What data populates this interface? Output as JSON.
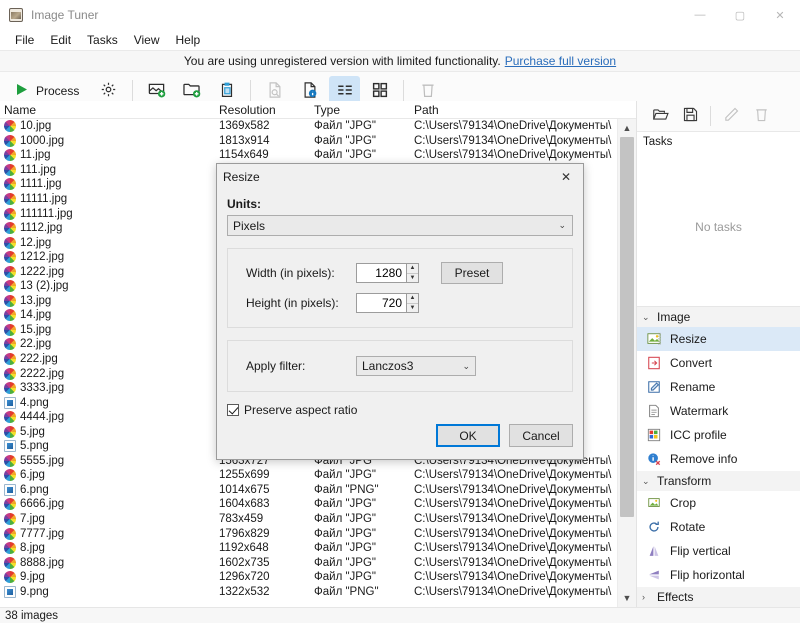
{
  "window": {
    "title": "Image Tuner",
    "app_icon": "image-tuner-icon",
    "minimize": "—",
    "maximize": "▢",
    "close": "✕"
  },
  "menu": [
    "File",
    "Edit",
    "Tasks",
    "View",
    "Help"
  ],
  "nag": {
    "text": "You are using unregistered version with limited functionality.",
    "link": "Purchase full version"
  },
  "toolbar": {
    "process_label": "Process",
    "items": [
      "settings-icon",
      "add-images-icon",
      "add-folder-icon",
      "paste-icon",
      "preview-icon",
      "info-icon",
      "list-view-icon",
      "grid-view-icon",
      "delete-icon"
    ]
  },
  "list": {
    "columns": [
      "Name",
      "Resolution",
      "Type",
      "Path"
    ],
    "rows": [
      {
        "name": "10.jpg",
        "kind": "jpg",
        "res": "1369x582",
        "type": "Файл \"JPG\"",
        "path": "C:\\Users\\79134\\OneDrive\\Документы\\"
      },
      {
        "name": "1000.jpg",
        "kind": "jpg",
        "res": "1813x914",
        "type": "Файл \"JPG\"",
        "path": "C:\\Users\\79134\\OneDrive\\Документы\\"
      },
      {
        "name": "11.jpg",
        "kind": "jpg",
        "res": "1154x649",
        "type": "Файл \"JPG\"",
        "path": "C:\\Users\\79134\\OneDrive\\Документы\\"
      },
      {
        "name": "111.jpg",
        "kind": "jpg",
        "res": "",
        "type": "",
        "path": ""
      },
      {
        "name": "1111.jpg",
        "kind": "jpg",
        "res": "",
        "type": "",
        "path": ""
      },
      {
        "name": "11111.jpg",
        "kind": "jpg",
        "res": "",
        "type": "",
        "path": ""
      },
      {
        "name": "111111.jpg",
        "kind": "jpg",
        "res": "",
        "type": "",
        "path": ""
      },
      {
        "name": "1112.jpg",
        "kind": "jpg",
        "res": "",
        "type": "",
        "path": ""
      },
      {
        "name": "12.jpg",
        "kind": "jpg",
        "res": "",
        "type": "",
        "path": ""
      },
      {
        "name": "1212.jpg",
        "kind": "jpg",
        "res": "",
        "type": "",
        "path": ""
      },
      {
        "name": "1222.jpg",
        "kind": "jpg",
        "res": "",
        "type": "",
        "path": ""
      },
      {
        "name": "13 (2).jpg",
        "kind": "jpg",
        "res": "",
        "type": "",
        "path": ""
      },
      {
        "name": "13.jpg",
        "kind": "jpg",
        "res": "",
        "type": "",
        "path": ""
      },
      {
        "name": "14.jpg",
        "kind": "jpg",
        "res": "",
        "type": "",
        "path": ""
      },
      {
        "name": "15.jpg",
        "kind": "jpg",
        "res": "",
        "type": "",
        "path": ""
      },
      {
        "name": "22.jpg",
        "kind": "jpg",
        "res": "",
        "type": "",
        "path": ""
      },
      {
        "name": "222.jpg",
        "kind": "jpg",
        "res": "",
        "type": "",
        "path": ""
      },
      {
        "name": "2222.jpg",
        "kind": "jpg",
        "res": "",
        "type": "",
        "path": ""
      },
      {
        "name": "3333.jpg",
        "kind": "jpg",
        "res": "",
        "type": "",
        "path": ""
      },
      {
        "name": "4.png",
        "kind": "png",
        "res": "",
        "type": "",
        "path": ""
      },
      {
        "name": "4444.jpg",
        "kind": "jpg",
        "res": "",
        "type": "",
        "path": ""
      },
      {
        "name": "5.jpg",
        "kind": "jpg",
        "res": "",
        "type": "",
        "path": ""
      },
      {
        "name": "5.png",
        "kind": "png",
        "res": "",
        "type": "",
        "path": ""
      },
      {
        "name": "5555.jpg",
        "kind": "jpg",
        "res": "1563x727",
        "type": "Файл \"JPG\"",
        "path": "C:\\Users\\79134\\OneDrive\\Документы\\"
      },
      {
        "name": "6.jpg",
        "kind": "jpg",
        "res": "1255x699",
        "type": "Файл \"JPG\"",
        "path": "C:\\Users\\79134\\OneDrive\\Документы\\"
      },
      {
        "name": "6.png",
        "kind": "png",
        "res": "1014x675",
        "type": "Файл \"PNG\"",
        "path": "C:\\Users\\79134\\OneDrive\\Документы\\"
      },
      {
        "name": "6666.jpg",
        "kind": "jpg",
        "res": "1604x683",
        "type": "Файл \"JPG\"",
        "path": "C:\\Users\\79134\\OneDrive\\Документы\\"
      },
      {
        "name": "7.jpg",
        "kind": "jpg",
        "res": "783x459",
        "type": "Файл \"JPG\"",
        "path": "C:\\Users\\79134\\OneDrive\\Документы\\"
      },
      {
        "name": "7777.jpg",
        "kind": "jpg",
        "res": "1796x829",
        "type": "Файл \"JPG\"",
        "path": "C:\\Users\\79134\\OneDrive\\Документы\\"
      },
      {
        "name": "8.jpg",
        "kind": "jpg",
        "res": "1192x648",
        "type": "Файл \"JPG\"",
        "path": "C:\\Users\\79134\\OneDrive\\Документы\\"
      },
      {
        "name": "8888.jpg",
        "kind": "jpg",
        "res": "1602x735",
        "type": "Файл \"JPG\"",
        "path": "C:\\Users\\79134\\OneDrive\\Документы\\"
      },
      {
        "name": "9.jpg",
        "kind": "jpg",
        "res": "1296x720",
        "type": "Файл \"JPG\"",
        "path": "C:\\Users\\79134\\OneDrive\\Документы\\"
      },
      {
        "name": "9.png",
        "kind": "png",
        "res": "1322x532",
        "type": "Файл \"PNG\"",
        "path": "C:\\Users\\79134\\OneDrive\\Документы\\"
      }
    ]
  },
  "status": {
    "text": "38 images"
  },
  "right": {
    "toolbar": [
      "open-icon",
      "save-icon",
      "edit-icon",
      "delete-icon"
    ],
    "tasks_label": "Tasks",
    "no_tasks": "No tasks",
    "groups": [
      {
        "label": "Image",
        "expanded": true,
        "chevron": "⌄",
        "items": [
          {
            "label": "Resize",
            "icon": "resize-icon",
            "selected": true
          },
          {
            "label": "Convert",
            "icon": "convert-icon",
            "selected": false
          },
          {
            "label": "Rename",
            "icon": "rename-icon",
            "selected": false
          },
          {
            "label": "Watermark",
            "icon": "watermark-icon",
            "selected": false
          },
          {
            "label": "ICC profile",
            "icon": "icc-profile-icon",
            "selected": false
          },
          {
            "label": "Remove info",
            "icon": "remove-info-icon",
            "selected": false
          }
        ]
      },
      {
        "label": "Transform",
        "expanded": true,
        "chevron": "⌄",
        "items": [
          {
            "label": "Crop",
            "icon": "crop-icon",
            "selected": false
          },
          {
            "label": "Rotate",
            "icon": "rotate-icon",
            "selected": false
          },
          {
            "label": "Flip vertical",
            "icon": "flip-vertical-icon",
            "selected": false
          },
          {
            "label": "Flip horizontal",
            "icon": "flip-horizontal-icon",
            "selected": false
          }
        ]
      },
      {
        "label": "Effects",
        "expanded": false,
        "chevron": "›",
        "items": []
      }
    ]
  },
  "dialog": {
    "title": "Resize",
    "close": "✕",
    "units_label": "Units:",
    "units_value": "Pixels",
    "width_label": "Width (in pixels):",
    "width_value": "1280",
    "height_label": "Height (in pixels):",
    "height_value": "720",
    "preset_label": "Preset",
    "filter_label": "Apply filter:",
    "filter_value": "Lanczos3",
    "preserve_label": "Preserve aspect ratio",
    "preserve_checked": true,
    "ok_label": "OK",
    "cancel_label": "Cancel",
    "spin_up": "▲",
    "spin_down": "▼",
    "combo_arrow": "⌄"
  }
}
